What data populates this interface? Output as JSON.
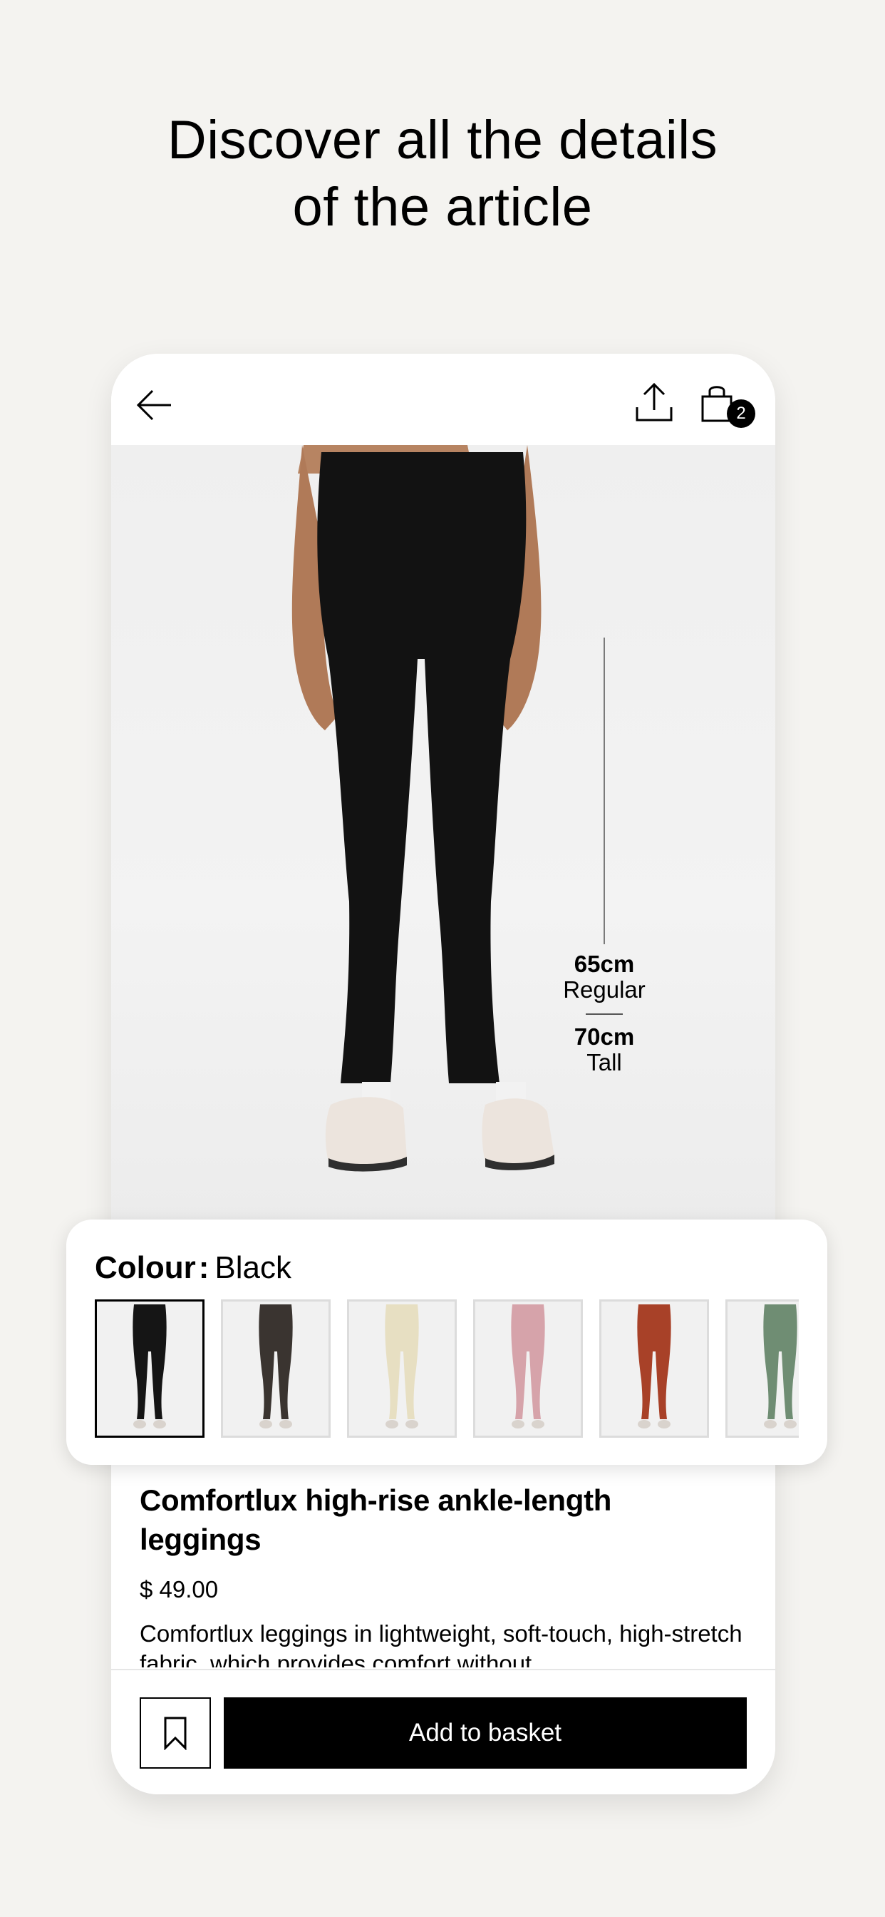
{
  "headline": {
    "line1": "Discover all the details",
    "line2": "of the article"
  },
  "header": {
    "back_icon": "arrow-left-icon",
    "share_icon": "share-icon",
    "bag_icon": "shopping-bag-icon",
    "bag_count": "2"
  },
  "hero": {
    "measure_top_value": "65cm",
    "measure_top_label": "Regular",
    "measure_bottom_value": "70cm",
    "measure_bottom_label": "Tall"
  },
  "colour": {
    "label": "Colour",
    "separator": ":",
    "value": "Black",
    "swatches": [
      {
        "color": "#151515",
        "selected": true
      },
      {
        "color": "#3a3430",
        "selected": false
      },
      {
        "color": "#e7dfc2",
        "selected": false
      },
      {
        "color": "#d6a3aa",
        "selected": false
      },
      {
        "color": "#a84128",
        "selected": false
      },
      {
        "color": "#6f8d73",
        "selected": false
      }
    ]
  },
  "product": {
    "title": "Comfortlux high-rise ankle-length leggings",
    "price": "$ 49.00",
    "description": "Comfortlux leggings in lightweight, soft-touch, high-stretch fabric, which provides comfort without"
  },
  "actions": {
    "save_icon": "bookmark-icon",
    "add_label": "Add to basket"
  }
}
